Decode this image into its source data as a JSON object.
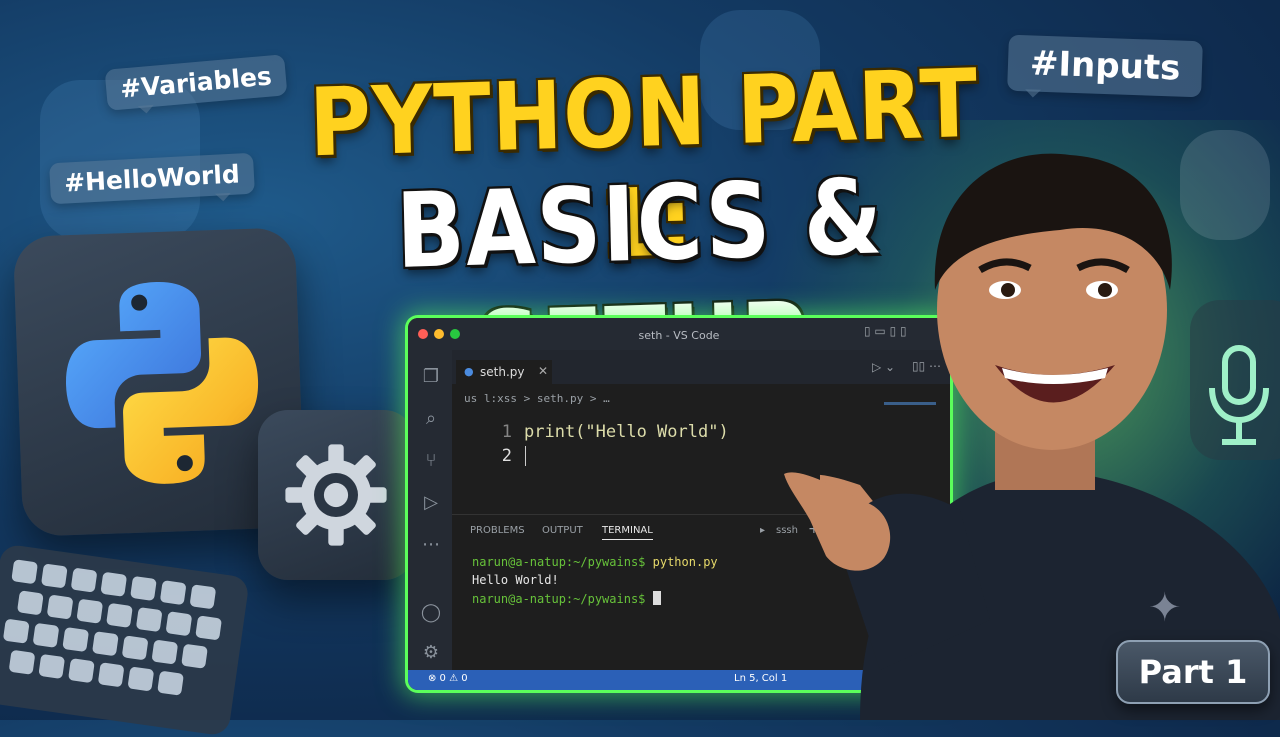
{
  "tags": {
    "variables": "#Variables",
    "helloworld": "#HelloWorld",
    "inputs": "#Inputs"
  },
  "title": {
    "line1": "PYTHON PART 1:",
    "line2": "BASICS & SETUP"
  },
  "vscode": {
    "window_title": "seth - VS Code",
    "tab_label": "seth.py",
    "breadcrumb": "us l:xss  >  seth.py > …",
    "lines": [
      {
        "num": "1",
        "code": "print(\"Hello World\")"
      },
      {
        "num": "2",
        "code": ""
      }
    ],
    "panel_tabs": [
      "PROBLEMS",
      "OUTPUT",
      "TERMINAL"
    ],
    "panel_shell": "sssh",
    "terminal": [
      {
        "prompt": "narun@a-natup:~/pywains$",
        "cmd": "python.py"
      },
      {
        "output": "Hello World!"
      },
      {
        "prompt": "narun@a-natup:~/pywains$",
        "cmd": ""
      }
    ],
    "status_left": "⊗ 0 ⚠ 0",
    "status_right": "Ln 5, Col 1"
  },
  "badge": "Part 1",
  "colors": {
    "title_yellow": "#ffd21f",
    "glow_green": "#5bff5b",
    "status_blue": "#2b60b7"
  },
  "icons": [
    "python-logo-icon",
    "gear-icon",
    "keyboard-icon",
    "microphone-icon",
    "sparkle-icon"
  ]
}
